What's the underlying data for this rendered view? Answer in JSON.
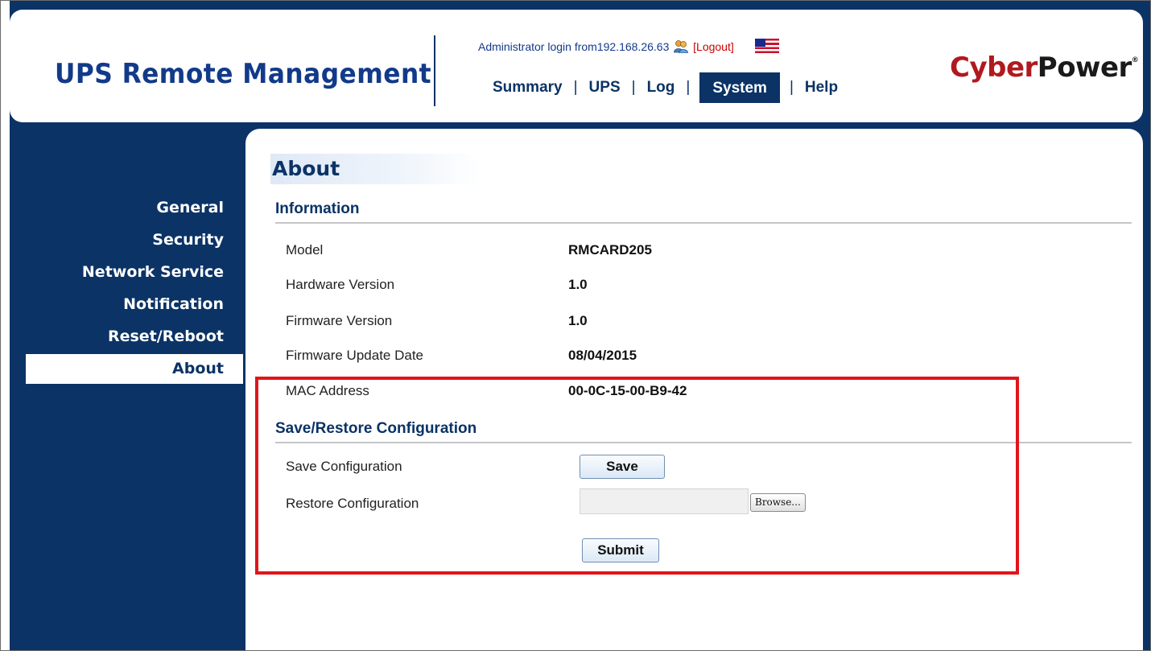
{
  "app": {
    "title": "UPS Remote Management",
    "logo_red": "Cyber",
    "logo_dark": "Power",
    "logo_mark": "®"
  },
  "header": {
    "login_text": "Administrator login from192.168.26.63",
    "logout_label": "[Logout]",
    "nav": [
      {
        "label": "Summary",
        "active": false
      },
      {
        "label": "UPS",
        "active": false
      },
      {
        "label": "Log",
        "active": false
      },
      {
        "label": "System",
        "active": true
      },
      {
        "label": "Help",
        "active": false
      }
    ]
  },
  "sidebar": {
    "items": [
      {
        "label": "General"
      },
      {
        "label": "Security"
      },
      {
        "label": "Network Service"
      },
      {
        "label": "Notification"
      },
      {
        "label": "Reset/Reboot"
      },
      {
        "label": "About",
        "active": true
      }
    ]
  },
  "main": {
    "title": "About",
    "information": {
      "heading": "Information",
      "rows": [
        {
          "label": "Model",
          "value": "RMCARD205"
        },
        {
          "label": "Hardware Version",
          "value": "1.0"
        },
        {
          "label": "Firmware Version",
          "value": "1.0"
        },
        {
          "label": "Firmware Update Date",
          "value": "08/04/2015"
        },
        {
          "label": "MAC Address",
          "value": "00-0C-15-00-B9-42"
        }
      ]
    },
    "config": {
      "heading": "Save/Restore Configuration",
      "save_label": "Save Configuration",
      "save_button": "Save",
      "restore_label": "Restore Configuration",
      "file_value": "",
      "browse_button": "Browse...",
      "submit_button": "Submit"
    }
  },
  "colors": {
    "navy": "#0b3366",
    "brand_blue": "#123a8a",
    "logo_red": "#b1191e",
    "highlight_red": "#e0151b"
  },
  "icons": {
    "user": "user-icon",
    "flag": "us-flag-icon"
  }
}
